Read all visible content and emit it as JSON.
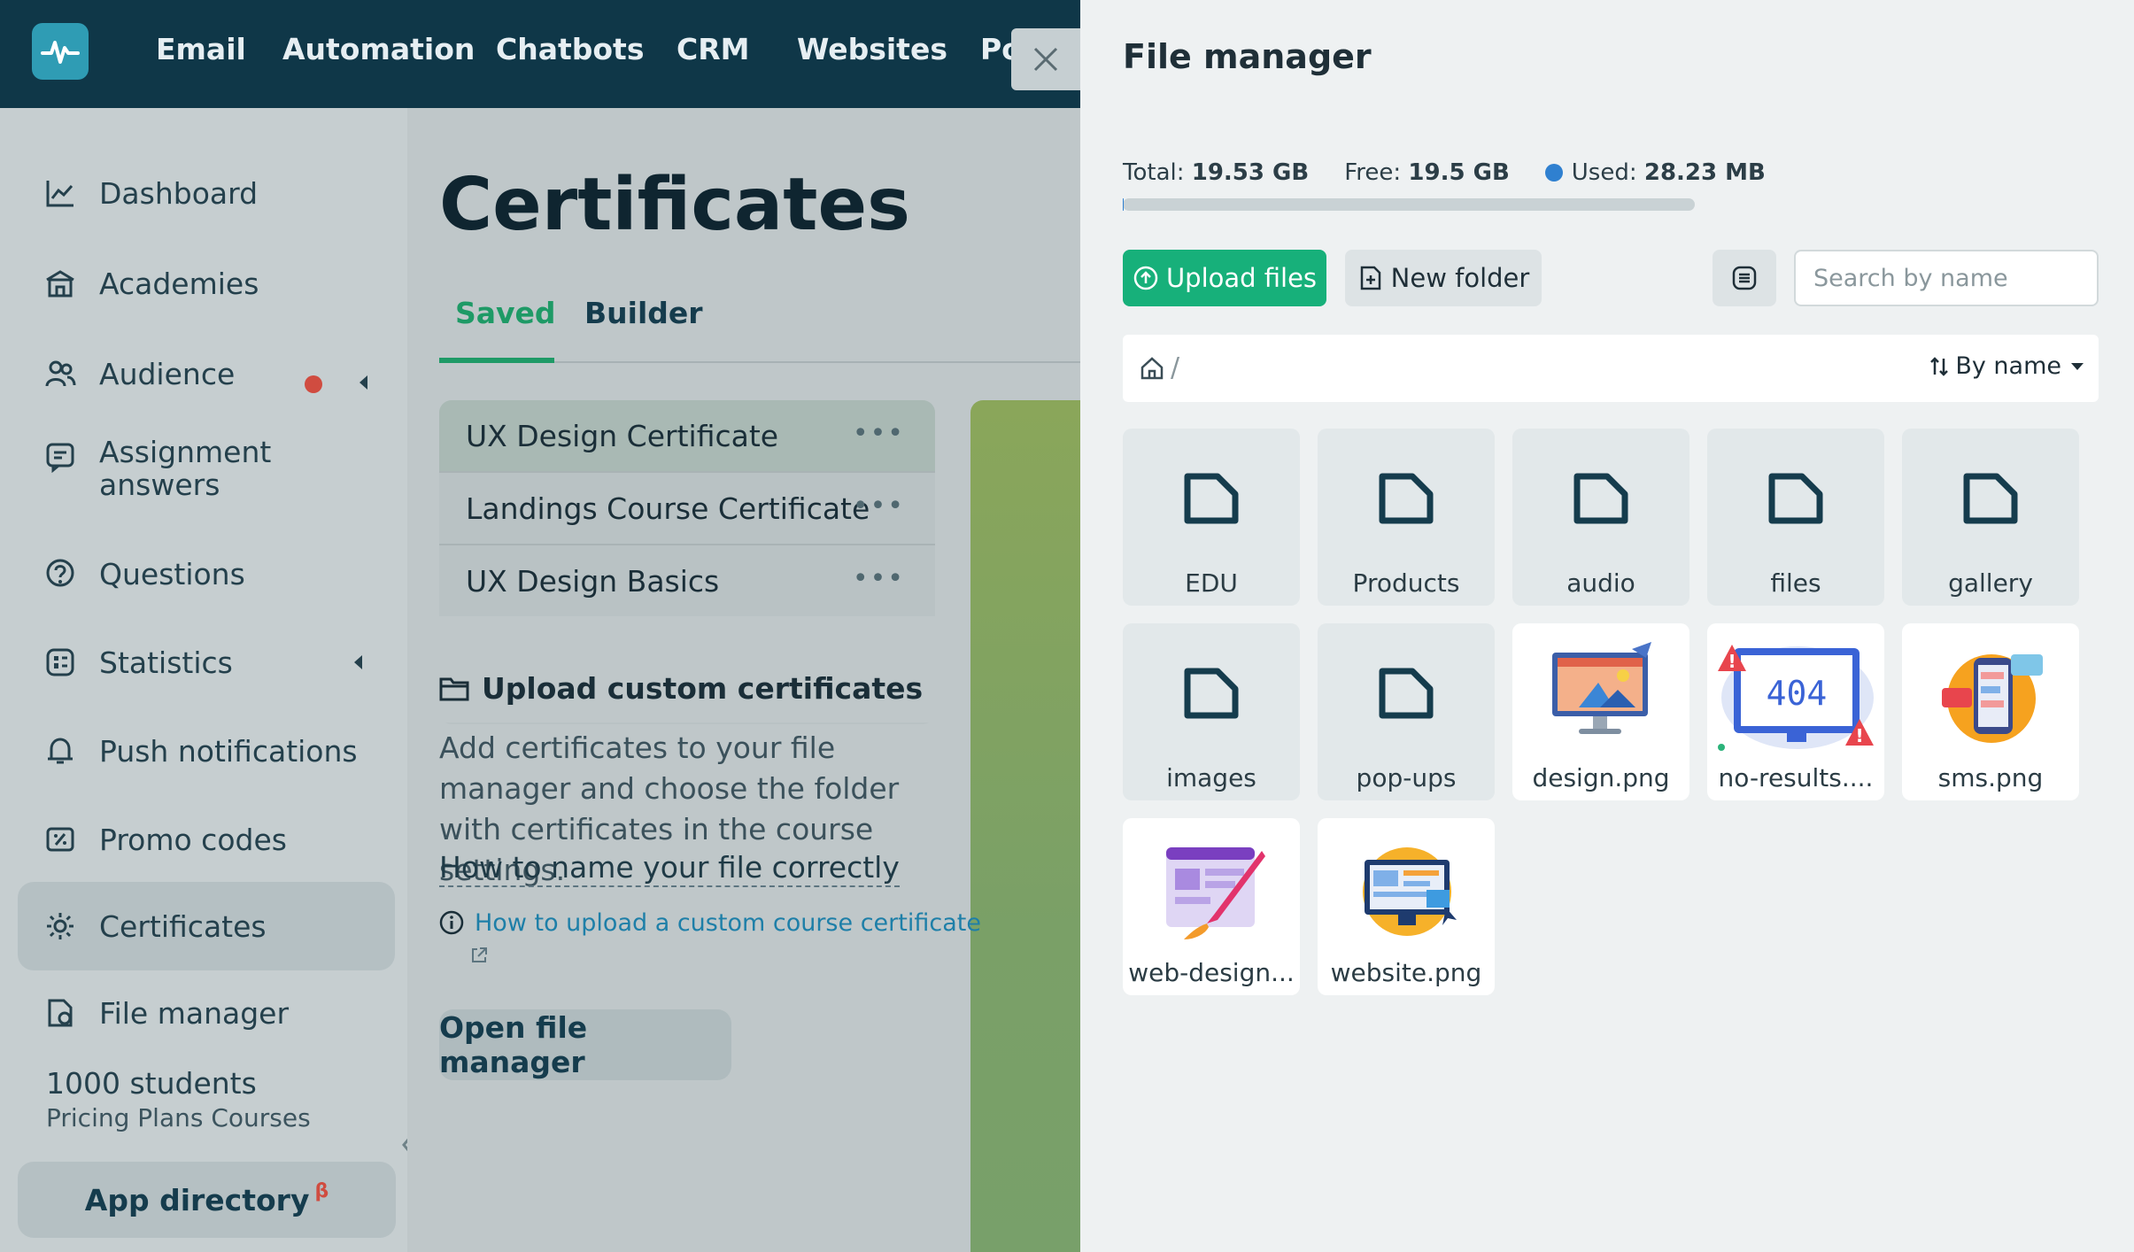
{
  "nav": {
    "items": [
      "Email",
      "Automation",
      "Chatbots",
      "CRM",
      "Websites",
      "Po"
    ]
  },
  "sidebar": {
    "items": [
      {
        "label": "Dashboard",
        "icon": "chart-line-icon"
      },
      {
        "label": "Academies",
        "icon": "academy-icon"
      },
      {
        "label": "Audience",
        "icon": "users-icon"
      },
      {
        "label": "Assignment answers",
        "icon": "assignment-icon"
      },
      {
        "label": "Questions",
        "icon": "question-icon"
      },
      {
        "label": "Statistics",
        "icon": "statistics-icon"
      },
      {
        "label": "Push notifications",
        "icon": "bell-icon"
      },
      {
        "label": "Promo codes",
        "icon": "promo-icon"
      },
      {
        "label": "Certificates",
        "icon": "gear-icon",
        "active": true
      },
      {
        "label": "File manager",
        "icon": "file-icon"
      }
    ],
    "plan": {
      "students": "1000 students",
      "subtitle": "Pricing Plans Courses"
    },
    "app_directory": "App directory",
    "app_directory_badge": "β"
  },
  "main": {
    "title": "Certificates",
    "tabs": [
      {
        "label": "Saved",
        "active": true
      },
      {
        "label": "Builder"
      }
    ],
    "certificates": [
      "UX Design Certificate",
      "Landings Course Certificate",
      "UX Design Basics"
    ],
    "more_label": "•••",
    "upload": {
      "heading": "Upload custom certificates",
      "text": "Add certificates to your file manager and choose the folder with certificates in the course settings.",
      "name_link": "How to name your file correctly",
      "help_link": "How to upload a custom course certificate",
      "open_button": "Open file manager"
    }
  },
  "file_manager": {
    "title": "File manager",
    "stats": {
      "total_label": "Total:",
      "total": "19.53 GB",
      "free_label": "Free:",
      "free": "19.5 GB",
      "used_label": "Used:",
      "used": "28.23 MB",
      "used_fraction": 0.0014
    },
    "upload_button": "Upload files",
    "new_folder_button": "New folder",
    "search_placeholder": "Search by name",
    "breadcrumb_separator": "/",
    "sort_label": "By name",
    "folders": [
      "EDU",
      "Products",
      "audio",
      "files",
      "gallery",
      "images",
      "pop-ups"
    ],
    "files": [
      "design.png",
      "no-results....",
      "sms.png",
      "web-design...",
      "website.png"
    ]
  },
  "colors": {
    "primary": "#17b07a",
    "nav_bg": "#0f3748",
    "accent_blue": "#2f80d0",
    "active_tab": "#1e9a66"
  }
}
